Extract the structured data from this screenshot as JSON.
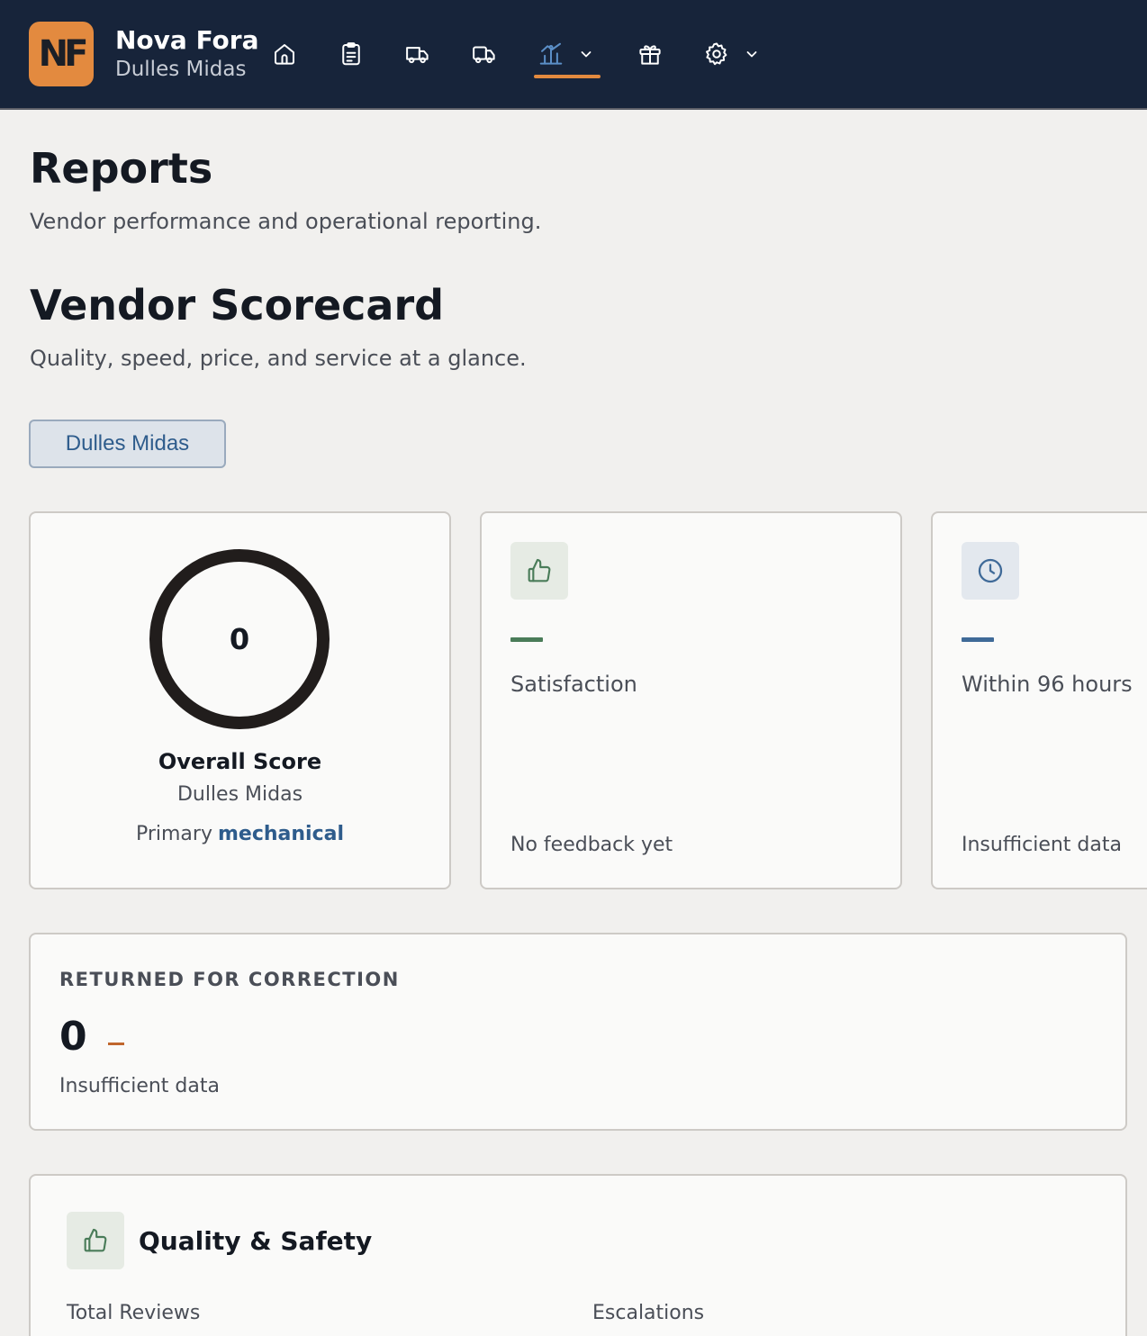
{
  "header": {
    "logo_text": "NF",
    "app_name": "Nova Fora",
    "vendor_name": "Dulles Midas",
    "nav": [
      {
        "icon": "home-icon"
      },
      {
        "icon": "clipboard-icon"
      },
      {
        "icon": "truck-icon"
      },
      {
        "icon": "truck-alt-icon"
      },
      {
        "icon": "reports-icon",
        "active": true
      },
      {
        "icon": "gift-icon"
      },
      {
        "icon": "gear-icon"
      }
    ],
    "accent_color": "#e38a3f"
  },
  "page": {
    "title": "Reports",
    "subtitle": "Vendor performance and operational reporting."
  },
  "scorecard": {
    "title": "Vendor Scorecard",
    "subtitle": "Quality, speed, price, and service at a glance.",
    "vendor_filter": "Dulles Midas"
  },
  "overall": {
    "score": "0",
    "label": "Overall Score",
    "vendor": "Dulles Midas",
    "primary_label": "Primary",
    "primary_category": "mechanical"
  },
  "satisfaction": {
    "icon": "thumbs-up-icon",
    "label": "Satisfaction",
    "footer": "No feedback yet",
    "color": "#4a7c59"
  },
  "timeliness": {
    "icon": "clock-icon",
    "label": "Within 96 hours",
    "footer": "Insufficient data",
    "color": "#3f6a98"
  },
  "returned": {
    "title": "RETURNED FOR CORRECTION",
    "value": "0",
    "footer": "Insufficient data"
  },
  "quality": {
    "icon": "thumbs-up-icon",
    "title": "Quality & Safety",
    "col1_label": "Total Reviews",
    "col2_label": "Escalations"
  }
}
